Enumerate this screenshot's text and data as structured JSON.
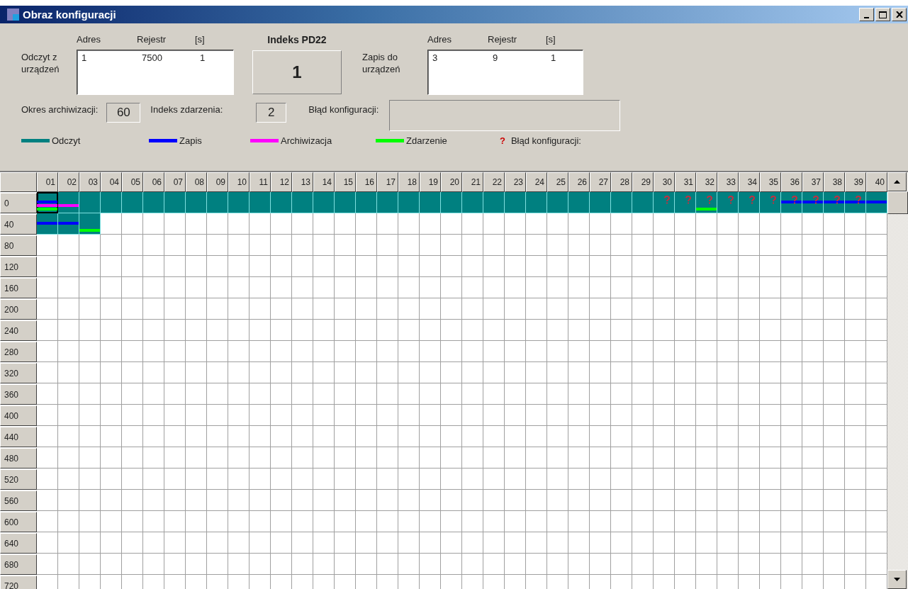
{
  "window": {
    "title": "Obraz konfiguracji"
  },
  "read_block": {
    "label": "Odczyt z urządzeń",
    "columns": [
      "Adres",
      "Rejestr",
      "[s]"
    ],
    "rows": [
      [
        "1",
        "7500",
        "1"
      ]
    ]
  },
  "index_block": {
    "title": "Indeks PD22",
    "value": "1"
  },
  "write_block": {
    "label": "Zapis do urządzeń",
    "columns": [
      "Adres",
      "Rejestr",
      "[s]"
    ],
    "rows": [
      [
        "3",
        "9",
        "1"
      ]
    ]
  },
  "archive_period": {
    "label": "Okres archiwizacji:",
    "value": "60"
  },
  "event_index": {
    "label": "Indeks zdarzenia:",
    "value": "2"
  },
  "config_error": {
    "label": "Błąd konfiguracji:"
  },
  "legend": [
    {
      "kind": "line",
      "label": "Odczyt",
      "color": "#008080"
    },
    {
      "kind": "line",
      "label": "Zapis",
      "color": "#0000ff"
    },
    {
      "kind": "line",
      "label": "Archiwizacja",
      "color": "#ff00ff"
    },
    {
      "kind": "line",
      "label": "Zdarzenie",
      "color": "#00ff00"
    },
    {
      "kind": "symbol",
      "symbol": "?",
      "label": "Błąd konfiguracji:",
      "color": "#cc0000"
    }
  ],
  "grid": {
    "columns": [
      "01",
      "02",
      "03",
      "04",
      "05",
      "06",
      "07",
      "08",
      "09",
      "10",
      "11",
      "12",
      "13",
      "14",
      "15",
      "16",
      "17",
      "18",
      "19",
      "20",
      "21",
      "22",
      "23",
      "24",
      "25",
      "26",
      "27",
      "28",
      "29",
      "30",
      "31",
      "32",
      "33",
      "34",
      "35",
      "36",
      "37",
      "38",
      "39",
      "40"
    ],
    "rows": [
      {
        "label": "0",
        "cells": [
          {
            "read": true,
            "write": true,
            "archive": true,
            "event": true,
            "error": false,
            "selected": true
          },
          {
            "read": true,
            "write": false,
            "archive": true,
            "event": false,
            "error": false,
            "selected": false
          },
          {
            "read": true,
            "write": false,
            "archive": false,
            "event": false,
            "error": false,
            "selected": false
          },
          {
            "read": true,
            "write": false,
            "archive": false,
            "event": false,
            "error": false,
            "selected": false
          },
          {
            "read": true,
            "write": false,
            "archive": false,
            "event": false,
            "error": false,
            "selected": false
          },
          {
            "read": true,
            "write": false,
            "archive": false,
            "event": false,
            "error": false,
            "selected": false
          },
          {
            "read": true,
            "write": false,
            "archive": false,
            "event": false,
            "error": false,
            "selected": false
          },
          {
            "read": true,
            "write": false,
            "archive": false,
            "event": false,
            "error": false,
            "selected": false
          },
          {
            "read": true,
            "write": false,
            "archive": false,
            "event": false,
            "error": false,
            "selected": false
          },
          {
            "read": true,
            "write": false,
            "archive": false,
            "event": false,
            "error": false,
            "selected": false
          },
          {
            "read": true,
            "write": false,
            "archive": false,
            "event": false,
            "error": false,
            "selected": false
          },
          {
            "read": true,
            "write": false,
            "archive": false,
            "event": false,
            "error": false,
            "selected": false
          },
          {
            "read": true,
            "write": false,
            "archive": false,
            "event": false,
            "error": false,
            "selected": false
          },
          {
            "read": true,
            "write": false,
            "archive": false,
            "event": false,
            "error": false,
            "selected": false
          },
          {
            "read": true,
            "write": false,
            "archive": false,
            "event": false,
            "error": false,
            "selected": false
          },
          {
            "read": true,
            "write": false,
            "archive": false,
            "event": false,
            "error": false,
            "selected": false
          },
          {
            "read": true,
            "write": false,
            "archive": false,
            "event": false,
            "error": false,
            "selected": false
          },
          {
            "read": true,
            "write": false,
            "archive": false,
            "event": false,
            "error": false,
            "selected": false
          },
          {
            "read": true,
            "write": false,
            "archive": false,
            "event": false,
            "error": false,
            "selected": false
          },
          {
            "read": true,
            "write": false,
            "archive": false,
            "event": false,
            "error": false,
            "selected": false
          },
          {
            "read": true,
            "write": false,
            "archive": false,
            "event": false,
            "error": false,
            "selected": false
          },
          {
            "read": true,
            "write": false,
            "archive": false,
            "event": false,
            "error": false,
            "selected": false
          },
          {
            "read": true,
            "write": false,
            "archive": false,
            "event": false,
            "error": false,
            "selected": false
          },
          {
            "read": true,
            "write": false,
            "archive": false,
            "event": false,
            "error": false,
            "selected": false
          },
          {
            "read": true,
            "write": false,
            "archive": false,
            "event": false,
            "error": false,
            "selected": false
          },
          {
            "read": true,
            "write": false,
            "archive": false,
            "event": false,
            "error": false,
            "selected": false
          },
          {
            "read": true,
            "write": false,
            "archive": false,
            "event": false,
            "error": false,
            "selected": false
          },
          {
            "read": true,
            "write": false,
            "archive": false,
            "event": false,
            "error": false,
            "selected": false
          },
          {
            "read": true,
            "write": false,
            "archive": false,
            "event": false,
            "error": false,
            "selected": false
          },
          {
            "read": true,
            "write": false,
            "archive": false,
            "event": false,
            "error": true,
            "selected": false
          },
          {
            "read": true,
            "write": false,
            "archive": false,
            "event": false,
            "error": true,
            "selected": false
          },
          {
            "read": true,
            "write": false,
            "archive": false,
            "event": true,
            "error": true,
            "selected": false
          },
          {
            "read": true,
            "write": false,
            "archive": false,
            "event": false,
            "error": true,
            "selected": false
          },
          {
            "read": true,
            "write": false,
            "archive": false,
            "event": false,
            "error": true,
            "selected": false
          },
          {
            "read": true,
            "write": false,
            "archive": false,
            "event": false,
            "error": true,
            "selected": false
          },
          {
            "read": true,
            "write": true,
            "archive": false,
            "event": false,
            "error": true,
            "selected": false
          },
          {
            "read": true,
            "write": true,
            "archive": false,
            "event": false,
            "error": true,
            "selected": false
          },
          {
            "read": true,
            "write": true,
            "archive": false,
            "event": false,
            "error": true,
            "selected": false
          },
          {
            "read": true,
            "write": true,
            "archive": false,
            "event": false,
            "error": true,
            "selected": false
          },
          {
            "read": true,
            "write": true,
            "archive": false,
            "event": false,
            "error": false,
            "selected": false
          }
        ]
      },
      {
        "label": "40",
        "cells": [
          {
            "read": true,
            "write": true,
            "archive": false,
            "event": false,
            "error": false,
            "selected": false
          },
          {
            "read": true,
            "write": true,
            "archive": false,
            "event": false,
            "error": false,
            "selected": false
          },
          {
            "read": true,
            "write": false,
            "archive": false,
            "event": true,
            "error": false,
            "selected": false
          }
        ]
      },
      {
        "label": "80"
      },
      {
        "label": "120"
      },
      {
        "label": "160"
      },
      {
        "label": "200"
      },
      {
        "label": "240"
      },
      {
        "label": "280"
      },
      {
        "label": "320"
      },
      {
        "label": "360"
      },
      {
        "label": "400"
      },
      {
        "label": "440"
      },
      {
        "label": "480"
      },
      {
        "label": "520"
      },
      {
        "label": "560"
      },
      {
        "label": "600"
      },
      {
        "label": "640"
      },
      {
        "label": "680"
      },
      {
        "label": "720"
      }
    ]
  }
}
